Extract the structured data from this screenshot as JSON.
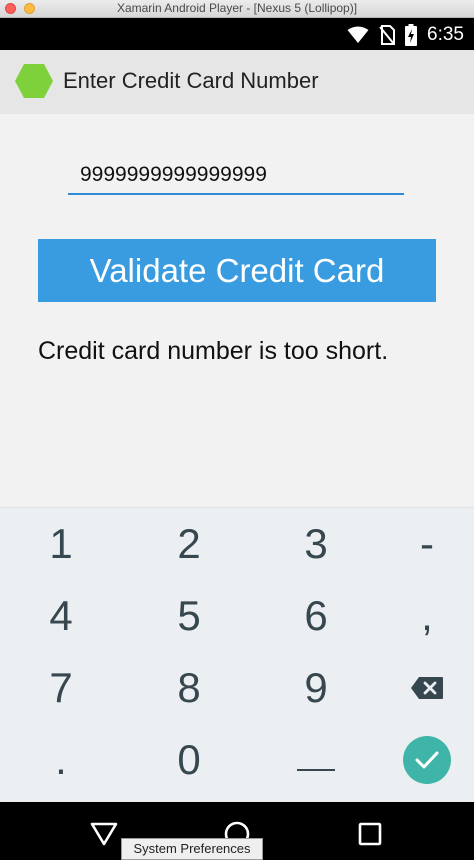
{
  "window": {
    "title": "Xamarin Android Player - [Nexus 5 (Lollipop)]"
  },
  "status_bar": {
    "time": "6:35",
    "icons": [
      "wifi-icon",
      "no-sim-icon",
      "battery-charging-icon"
    ]
  },
  "app_bar": {
    "title": "Enter Credit Card Number",
    "logo_icon": "hexagon-logo-icon",
    "logo_color": "#7ed13b"
  },
  "form": {
    "card_number_value": "9999999999999999",
    "validate_label": "Validate Credit Card",
    "result_message": "Credit card number is too short."
  },
  "keyboard": {
    "keys": [
      "1",
      "2",
      "3",
      "-",
      "4",
      "5",
      "6",
      ",",
      "7",
      "8",
      "9",
      "backspace-icon",
      ".",
      "0",
      "space-icon",
      "enter-check-icon"
    ],
    "labels": {
      "k1": "1",
      "k2": "2",
      "k3": "3",
      "dash": "-",
      "k4": "4",
      "k5": "5",
      "k6": "6",
      "comma": ",",
      "k7": "7",
      "k8": "8",
      "k9": "9",
      "dot": ".",
      "k0": "0"
    }
  },
  "nav_bar": {
    "buttons": [
      "back-icon",
      "home-icon",
      "recents-icon"
    ]
  },
  "tooltip": {
    "text": "System Preferences"
  },
  "colors": {
    "accent": "#3a9ce0",
    "input_underline": "#2f8bd6",
    "enter_key": "#3fb5a9",
    "status_bar": "#000000",
    "app_bar": "#e6e6e6"
  }
}
